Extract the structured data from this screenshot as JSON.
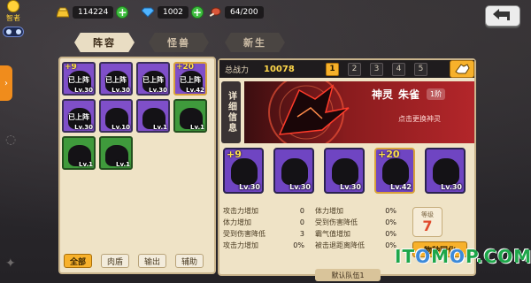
{
  "hero": {
    "label": "智者"
  },
  "resources": [
    {
      "name": "gold",
      "icon": "gold-bar-icon",
      "amount": "114224"
    },
    {
      "name": "gems",
      "icon": "diamond-icon",
      "amount": "1002"
    },
    {
      "name": "food",
      "icon": "meat-icon",
      "amount": "64/200"
    }
  ],
  "tabs": [
    {
      "label": "阵容",
      "active": true
    },
    {
      "label": "怪兽",
      "active": false
    },
    {
      "label": "新生",
      "active": false
    }
  ],
  "roster": {
    "cards": [
      {
        "star": "+9",
        "tag": "已上阵",
        "level": "Lv.30",
        "color": "purple"
      },
      {
        "star": "",
        "tag": "已上阵",
        "level": "Lv.30",
        "color": "purple"
      },
      {
        "star": "",
        "tag": "已上阵",
        "level": "Lv.30",
        "color": "purple"
      },
      {
        "star": "+20",
        "tag": "已上阵",
        "level": "Lv.42",
        "color": "gold"
      },
      {
        "star": "",
        "tag": "已上阵",
        "level": "Lv.30",
        "color": "purple"
      },
      {
        "star": "",
        "tag": "",
        "level": "Lv.10",
        "color": "purple"
      },
      {
        "star": "",
        "tag": "",
        "level": "Lv.1",
        "color": "purple"
      },
      {
        "star": "",
        "tag": "",
        "level": "Lv.1",
        "color": "green"
      },
      {
        "star": "",
        "tag": "",
        "level": "Lv.1",
        "color": "green"
      },
      {
        "star": "",
        "tag": "",
        "level": "Lv.1",
        "color": "green"
      }
    ],
    "filters": [
      {
        "label": "全部",
        "active": true
      },
      {
        "label": "肉盾",
        "active": false
      },
      {
        "label": "输出",
        "active": false
      },
      {
        "label": "辅助",
        "active": false
      }
    ]
  },
  "power": {
    "label": "总战力",
    "value": "10078",
    "pages": [
      "1",
      "2",
      "3",
      "4",
      "5"
    ],
    "active_page": "1"
  },
  "detail_tab": "详细信息",
  "god": {
    "type": "神灵",
    "name": "朱雀",
    "rank": "1阶",
    "hint": "点击更换神灵"
  },
  "team_slots": [
    {
      "star": "+9",
      "level": "Lv.30",
      "gold": false
    },
    {
      "star": "",
      "level": "Lv.30",
      "gold": false
    },
    {
      "star": "",
      "level": "Lv.30",
      "gold": false
    },
    {
      "star": "+20",
      "level": "Lv.42",
      "gold": true
    },
    {
      "star": "",
      "level": "Lv.30",
      "gold": false
    }
  ],
  "stats": [
    {
      "name1": "攻击力增加",
      "val1": "0",
      "name2": "体力增加",
      "val2": "0%"
    },
    {
      "name1": "体力增加",
      "val1": "0",
      "name2": "受到伤害降低",
      "val2": "0%"
    },
    {
      "name1": "受到伤害降低",
      "val1": "3",
      "name2": "霸气值增加",
      "val2": "0%"
    },
    {
      "name1": "攻击力增加",
      "val1": "0%",
      "name2": "被击退距离降低",
      "val2": "0%"
    }
  ],
  "level": {
    "label": "等级",
    "value": "7"
  },
  "convert_label": "物种同化",
  "team_label": "默认队伍1",
  "watermark": {
    "part1": "IT",
    "part2": "M",
    "o": "O",
    "part3": "P.COM"
  },
  "colors": {
    "accent": "#f7b12b",
    "panel": "#efe3c6",
    "purple": "#7f4fc9",
    "green": "#3f9a3c",
    "banner": "#b3262a"
  }
}
